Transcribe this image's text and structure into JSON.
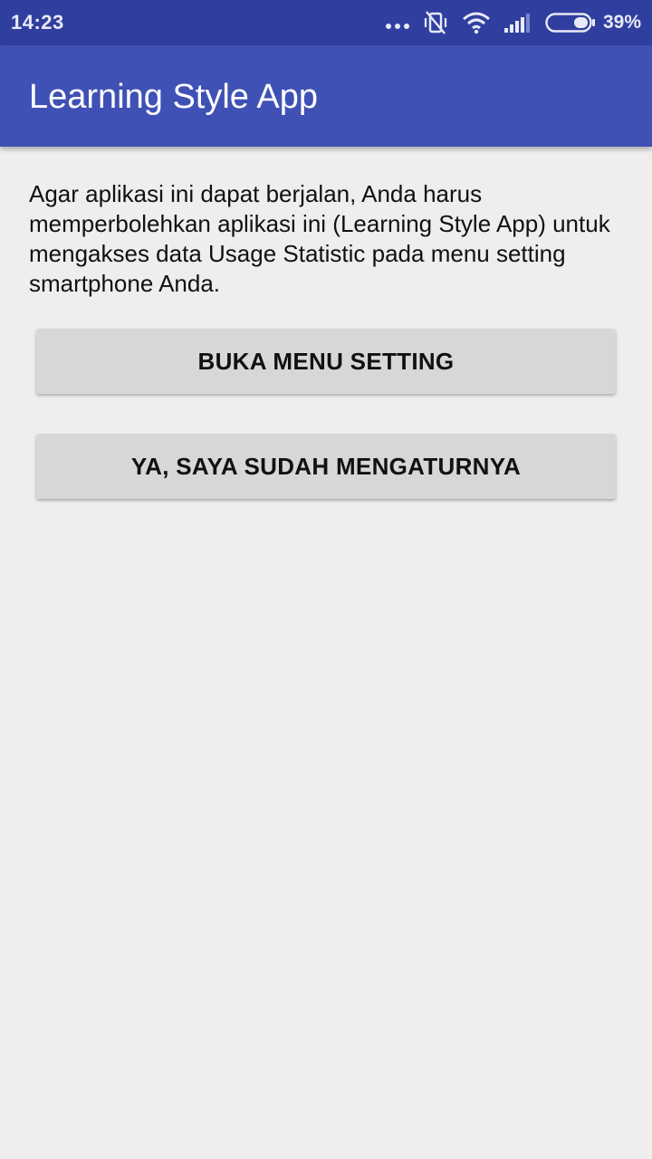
{
  "status_bar": {
    "time": "14:23",
    "battery_percent": "39%",
    "icons": [
      "more-dots-icon",
      "vibrate-off-icon",
      "wifi-icon",
      "signal-icon",
      "battery-icon"
    ],
    "battery_level": 0.39
  },
  "app_bar": {
    "title": "Learning Style App",
    "color": "#3f51b5"
  },
  "main": {
    "message": "Agar aplikasi ini dapat berjalan, Anda harus memperbolehkan aplikasi ini (Learning Style App) untuk mengakses data Usage Statistic pada menu setting smartphone Anda.",
    "open_settings_label": "BUKA MENU SETTING",
    "confirm_label": "YA, SAYA SUDAH MENGATURNYA"
  },
  "colors": {
    "status_bar": "#303f9f",
    "background": "#eeeeee",
    "button": "#d6d7d7"
  }
}
